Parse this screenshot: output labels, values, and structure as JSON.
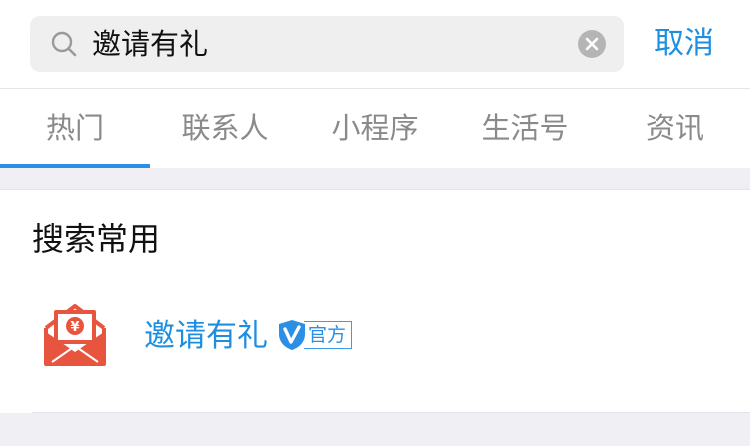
{
  "search": {
    "query": "邀请有礼",
    "cancel_label": "取消"
  },
  "tabs": [
    {
      "label": "热门",
      "active": true
    },
    {
      "label": "联系人",
      "active": false
    },
    {
      "label": "小程序",
      "active": false
    },
    {
      "label": "生活号",
      "active": false
    },
    {
      "label": "资讯",
      "active": false
    }
  ],
  "section": {
    "title": "搜索常用"
  },
  "results": [
    {
      "name": "邀请有礼",
      "badge": "官方",
      "icon": "red-envelope-icon",
      "badge_icon": "verified-shield-icon"
    }
  ],
  "colors": {
    "accent": "#1e8fe0",
    "icon_red": "#e8553f",
    "tab_inactive": "#8a8a8a"
  }
}
